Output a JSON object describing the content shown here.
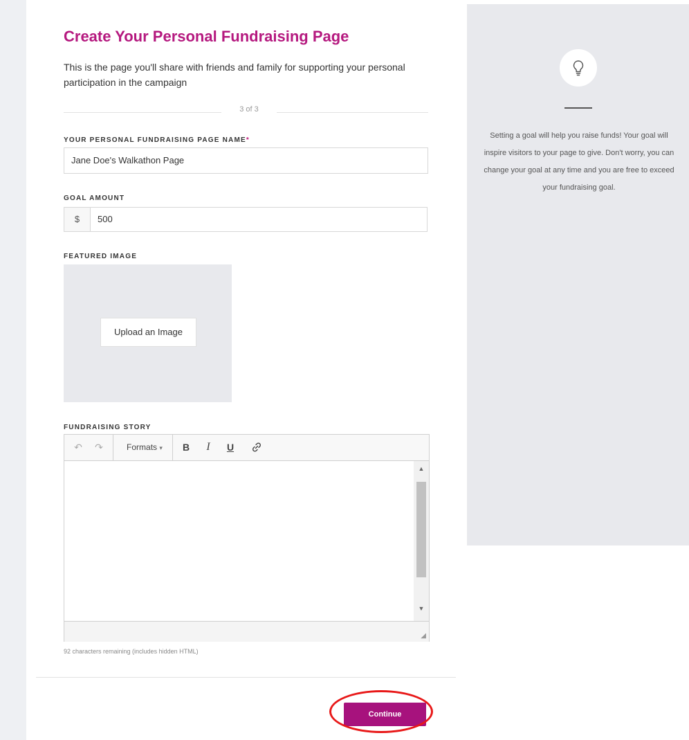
{
  "form": {
    "title": "Create Your Personal Fundraising Page",
    "intro": "This is the page you'll share with friends and family for supporting your personal participation in the campaign",
    "step": "3 of 3",
    "page_name": {
      "label": "YOUR PERSONAL FUNDRAISING PAGE NAME",
      "required_mark": "*",
      "value": "Jane Doe's Walkathon Page"
    },
    "goal": {
      "label": "GOAL AMOUNT",
      "currency": "$",
      "value": "500"
    },
    "featured_image": {
      "label": "FEATURED IMAGE",
      "upload_label": "Upload an Image"
    },
    "story": {
      "label": "FUNDRAISING STORY",
      "toolbar": {
        "formats_label": "Formats",
        "bold": "B",
        "italic": "I",
        "underline": "U"
      },
      "char_count": "92 characters remaining (includes hidden HTML)"
    },
    "continue_label": "Continue"
  },
  "tip": {
    "icon": "lightbulb-icon",
    "text": "Setting a goal will help you raise funds! Your goal will inspire visitors to your page to give. Don't worry, you can change your goal at any time and you are free to exceed your fundraising goal."
  },
  "colors": {
    "accent": "#b5197f",
    "button": "#a7127d",
    "highlight": "#e81818",
    "aside_bg": "#e8e9ed"
  }
}
